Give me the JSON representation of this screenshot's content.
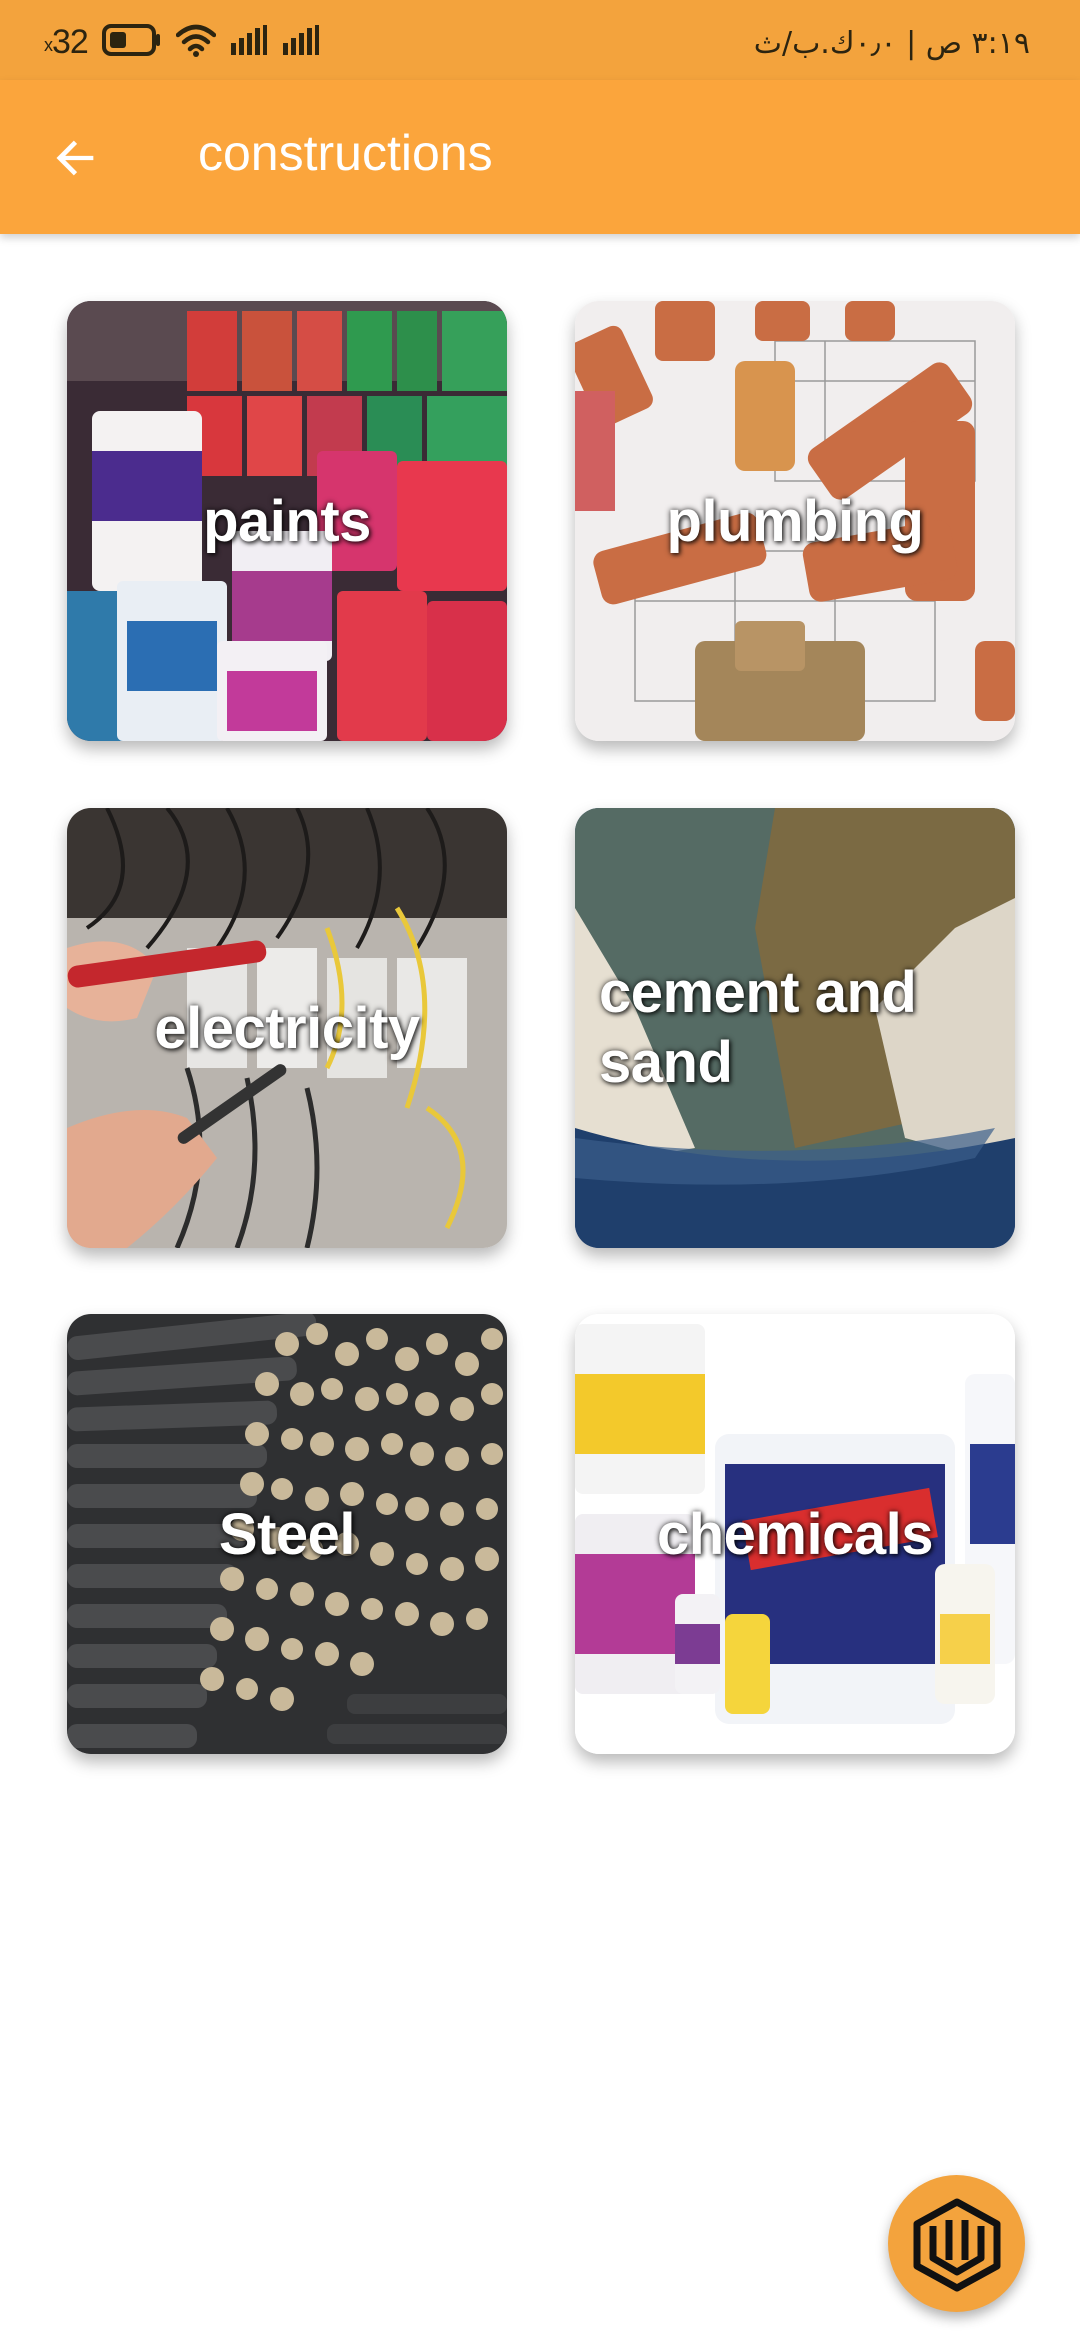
{
  "status_bar": {
    "battery": "32",
    "battery_suffix": "x",
    "time_info": "٣:١٩ ص | ٠٫٠ك.ب/ث"
  },
  "app_bar": {
    "title": "constructions",
    "back_icon": "arrow-back-icon"
  },
  "categories": [
    {
      "label": "paints"
    },
    {
      "label": "plumbing"
    },
    {
      "label": "electricity"
    },
    {
      "label": "cement and sand"
    },
    {
      "label": "Steel"
    },
    {
      "label": "chemicals"
    }
  ],
  "fab": {
    "icon": "brand-logo-icon"
  },
  "colors": {
    "primary": "#fba53c",
    "status_bar": "#f3a33d",
    "background": "#ffffff"
  }
}
